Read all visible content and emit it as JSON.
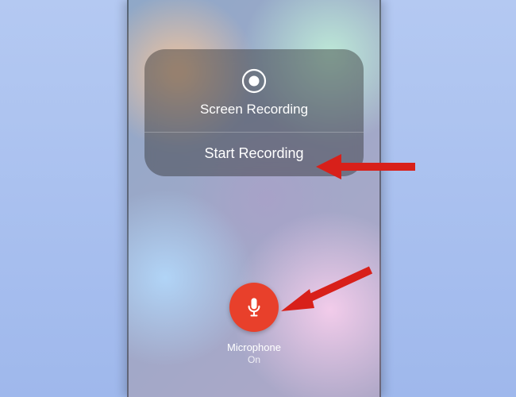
{
  "panel": {
    "title": "Screen Recording",
    "start_label": "Start Recording"
  },
  "microphone": {
    "label": "Microphone",
    "status": "On"
  },
  "colors": {
    "mic_button": "#e8402b",
    "annotation_arrow": "#d8201a"
  }
}
